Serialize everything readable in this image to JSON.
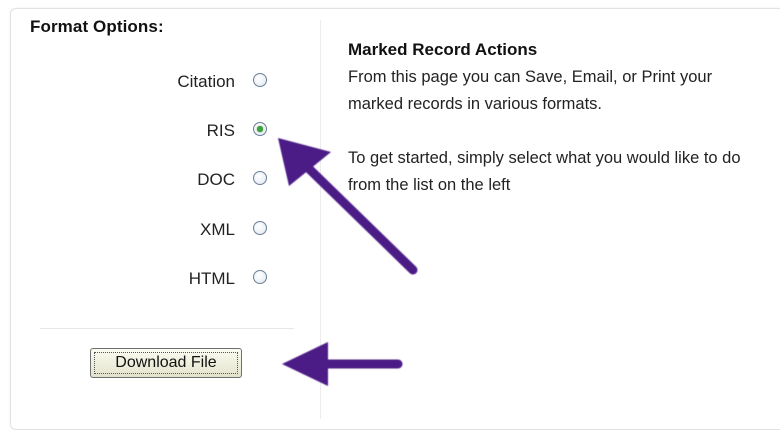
{
  "format_options": {
    "title": "Format Options:",
    "options": [
      {
        "label": "Citation",
        "selected": false
      },
      {
        "label": "RIS",
        "selected": true
      },
      {
        "label": "DOC",
        "selected": false
      },
      {
        "label": "XML",
        "selected": false
      },
      {
        "label": "HTML",
        "selected": false
      }
    ],
    "download_label": "Download File"
  },
  "info": {
    "heading": "Marked Record Actions",
    "paragraph1": "From this page you can Save, Email, or Print your marked records in various formats.",
    "paragraph2": "To get started, simply select what you would like to do from the list on the left"
  },
  "colors": {
    "arrow": "#4b1a86",
    "radio_selected": "#3ea33a"
  }
}
